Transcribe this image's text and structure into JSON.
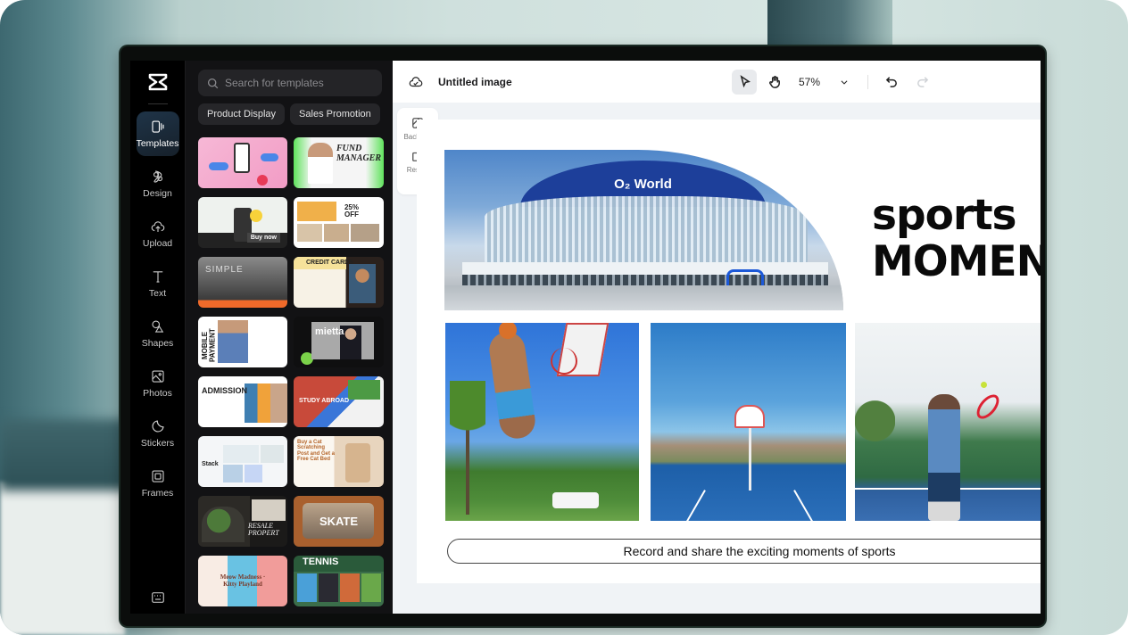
{
  "app": {
    "logo": "capcut-logo-icon"
  },
  "rail": {
    "items": [
      {
        "label": "Templates",
        "icon": "templates-icon",
        "active": true
      },
      {
        "label": "Design",
        "icon": "design-icon"
      },
      {
        "label": "Upload",
        "icon": "upload-cloud-icon"
      },
      {
        "label": "Text",
        "icon": "text-icon"
      },
      {
        "label": "Shapes",
        "icon": "shapes-icon"
      },
      {
        "label": "Photos",
        "icon": "photos-icon"
      },
      {
        "label": "Stickers",
        "icon": "stickers-icon"
      },
      {
        "label": "Frames",
        "icon": "frames-icon"
      }
    ],
    "bottom_icon": "keyboard-shortcuts-icon"
  },
  "templates_panel": {
    "search_placeholder": "Search for templates",
    "chips": [
      "Product Display",
      "Sales Promotion"
    ],
    "templates": [
      {
        "label": "",
        "theme": "pink-phone-sale"
      },
      {
        "label": "FUND MANAGER",
        "theme": "fund-manager"
      },
      {
        "label": "Buy now",
        "theme": "app-promo"
      },
      {
        "label": "25% OFF",
        "theme": "interior-sale"
      },
      {
        "label": "SIMPLE",
        "theme": "architecture"
      },
      {
        "label": "CREDIT CARDS",
        "theme": "credit-cards"
      },
      {
        "label": "MOBILE PAYMENT",
        "theme": "mobile-payment"
      },
      {
        "label": "mietta",
        "theme": "mietta"
      },
      {
        "label": "ADMISSION",
        "theme": "admission"
      },
      {
        "label": "STUDY ABROAD",
        "theme": "study-abroad"
      },
      {
        "label": "Stack",
        "theme": "stack-dashboard"
      },
      {
        "label": "Buy a Cat Scratching Post and Get a Free Cat Bed",
        "theme": "cat-scratching"
      },
      {
        "label": "RESALE PROPERT",
        "theme": "resale-property"
      },
      {
        "label": "SKATE",
        "theme": "skate"
      },
      {
        "label": "Meow Madness · Kitty Playland",
        "theme": "kitty-playland"
      },
      {
        "label": "TENNIS",
        "theme": "tennis"
      }
    ]
  },
  "editor": {
    "title": "Untitled image",
    "zoom": "57%",
    "tools": {
      "select": "select-pointer-icon",
      "hand": "hand-pan-icon",
      "undo": "undo-icon",
      "redo": "redo-icon"
    },
    "side_tools": [
      {
        "label": "Backgr...",
        "icon": "background-icon"
      },
      {
        "label": "Resize",
        "icon": "resize-icon"
      }
    ]
  },
  "canvas": {
    "arena_sign": "O₂ World",
    "headline_line1": "sports",
    "headline_line2": "MOMENTS",
    "caption": "Record and share the exciting moments of sports"
  }
}
